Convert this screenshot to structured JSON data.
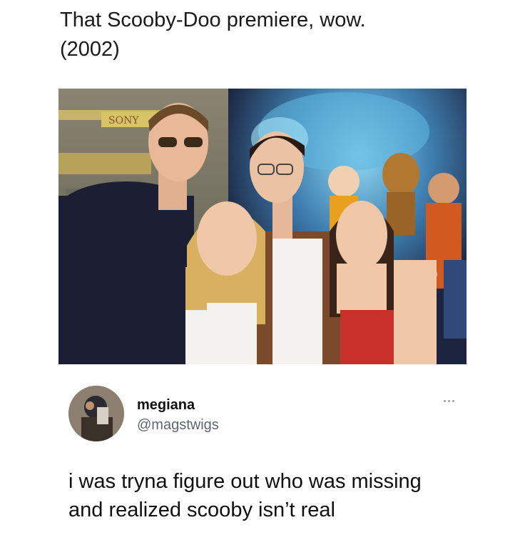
{
  "post": {
    "caption_lines": [
      "That Scooby-Doo premiere, wow.",
      "(2002)"
    ]
  },
  "photo": {
    "poster_sign": "SONY",
    "colors": {
      "backdrop": "#2b3a5c",
      "poster_glow": "#5fb8e0",
      "black_sweater": "#1c1f33",
      "white_top": "#f4f2ee",
      "brown_jacket": "#7a4a2a",
      "red_dress": "#c8302a"
    }
  },
  "tweet": {
    "display_name": "megiana",
    "handle": "@magstwigs",
    "more_icon": "more-horizontal-icon",
    "text_lines": [
      "i was tryna figure out who was missing",
      "and realized scooby isn’t real"
    ]
  }
}
